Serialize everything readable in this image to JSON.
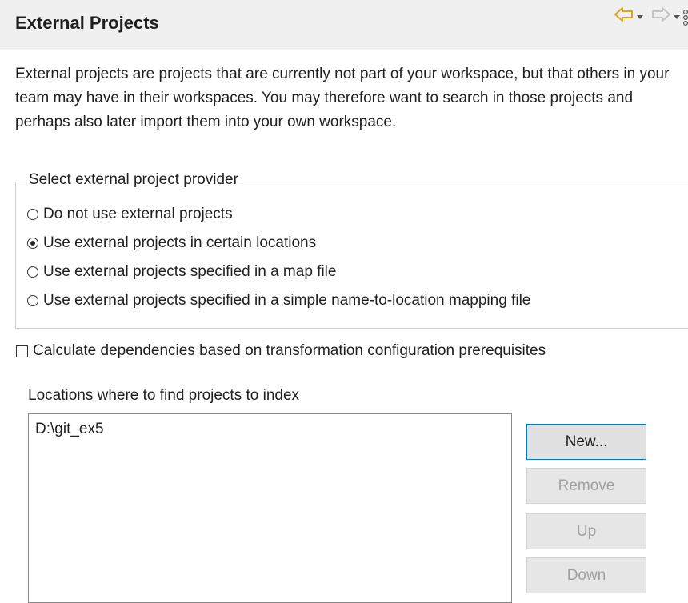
{
  "header": {
    "title": "External Projects",
    "nav_icons": [
      "back-arrow-icon",
      "dropdown-icon",
      "forward-arrow-icon",
      "dropdown-icon",
      "menu-dots-icon"
    ]
  },
  "description": "External projects are projects that are currently not part of your workspace, but that others in your team may have in their workspaces. You may therefore want to search in those projects and perhaps also later import them into your own workspace.",
  "provider_group": {
    "label": "Select external project provider",
    "options": [
      {
        "label": "Do not use external projects",
        "selected": false
      },
      {
        "label": "Use external projects in certain locations",
        "selected": true
      },
      {
        "label": "Use external projects specified in a map file",
        "selected": false
      },
      {
        "label": "Use external projects specified in a simple name-to-location mapping file",
        "selected": false
      }
    ]
  },
  "dependencies_checkbox": {
    "label": "Calculate dependencies based on transformation configuration prerequisites",
    "checked": false
  },
  "locations": {
    "label": "Locations where to find projects to index",
    "items": [
      "D:\\git_ex5"
    ]
  },
  "buttons": {
    "new": "New...",
    "remove": "Remove",
    "up": "Up",
    "down": "Down"
  },
  "colors": {
    "header_bg": "#f0f0f0",
    "back_arrow": "#e8b93a",
    "forward_arrow_disabled": "#c8c8c8",
    "focus_border": "#0078d7"
  }
}
